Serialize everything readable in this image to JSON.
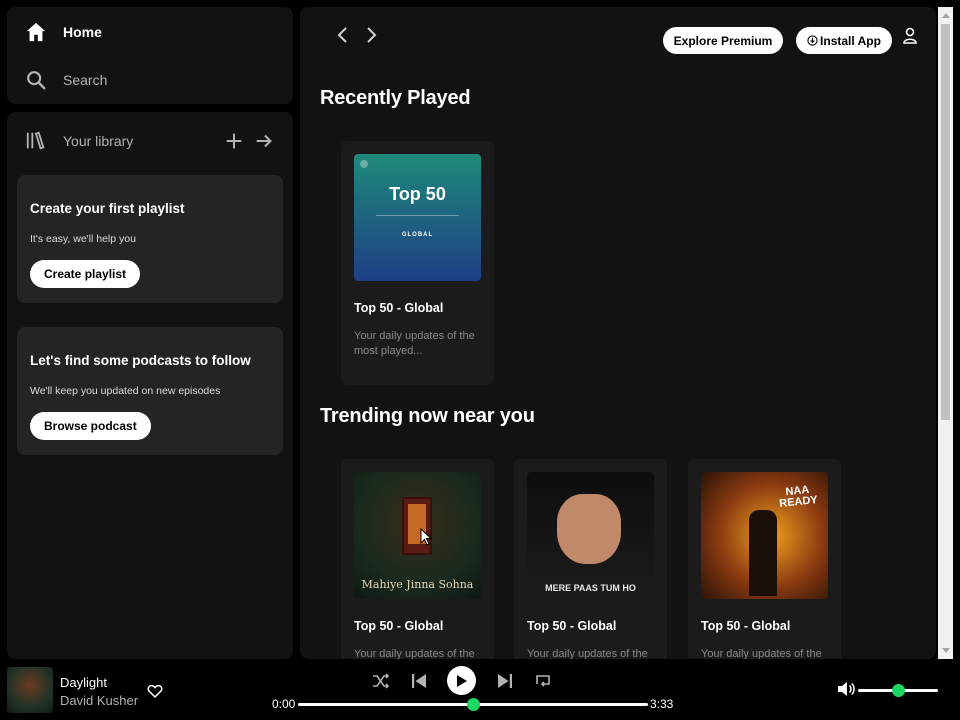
{
  "nav": {
    "home": "Home",
    "search": "Search"
  },
  "library": {
    "title": "Your library",
    "promos": [
      {
        "title": "Create your first playlist",
        "text": "It's easy, we'll help you",
        "button": "Create playlist"
      },
      {
        "title": "Let's find some podcasts to follow",
        "text": "We'll keep you updated on new episodes",
        "button": "Browse podcast"
      }
    ]
  },
  "topbar": {
    "premium": "Explore Premium",
    "install": "Install App"
  },
  "sections": {
    "recent": {
      "title": "Recently Played",
      "cards": [
        {
          "name": "Top 50 - Global",
          "desc": "Your daily updates of the most played...",
          "cover_title": "Top 50",
          "cover_sub": "GLOBAL"
        }
      ]
    },
    "trending": {
      "title": "Trending now near you",
      "cards": [
        {
          "name": "Top 50 - Global",
          "desc": "Your daily updates of the",
          "cover_caption": "Mahiye Jinna Sohna"
        },
        {
          "name": "Top 50 - Global",
          "desc": "Your daily updates of the",
          "cover_caption": "MERE PAAS TUM HO"
        },
        {
          "name": "Top 50 - Global",
          "desc": "Your daily updates of the",
          "cover_caption": "NAA READY"
        }
      ]
    }
  },
  "player": {
    "title": "Daylight",
    "artist": "David Kusher",
    "time_current": "0:00",
    "time_total": "3:33",
    "progress_fraction": 0.5,
    "volume_fraction": 0.5
  },
  "colors": {
    "accent": "#1ed760",
    "panel": "#121212",
    "card": "#1b1b1b"
  }
}
